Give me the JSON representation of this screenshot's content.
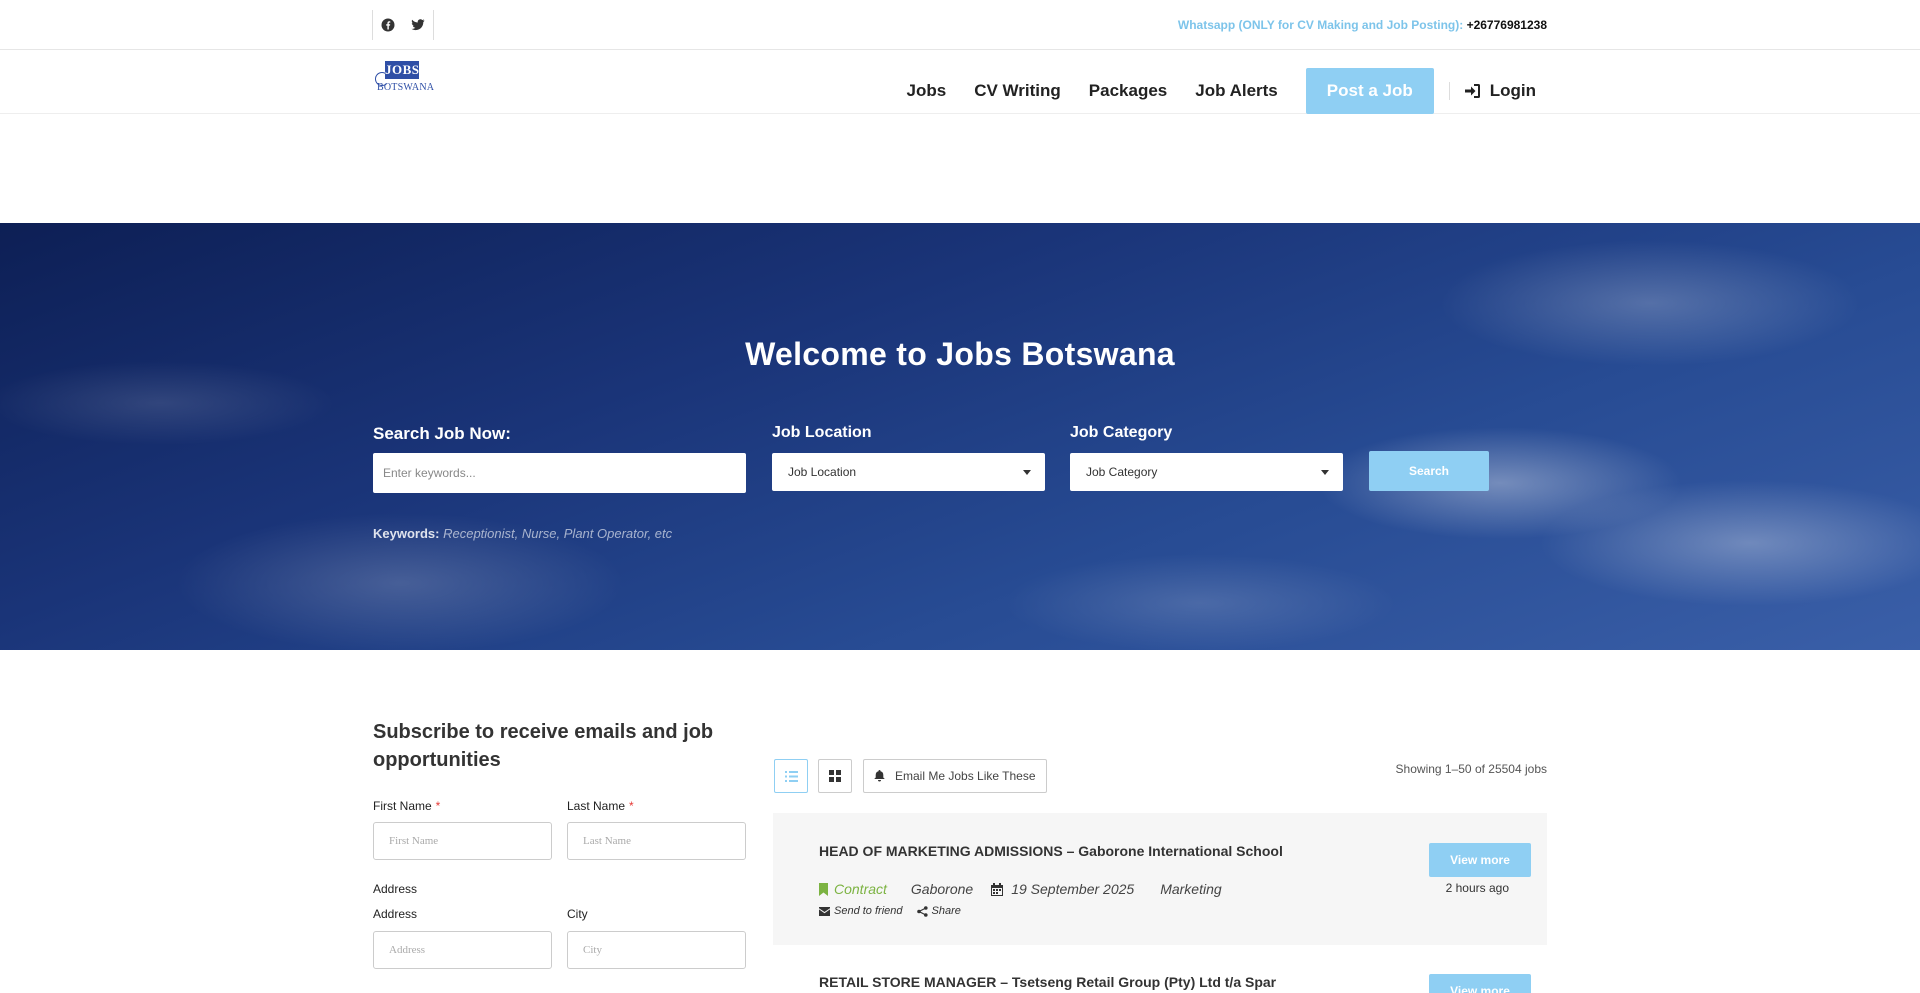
{
  "topbar": {
    "social_icons": [
      "facebook-icon",
      "twitter-icon"
    ],
    "whatsapp_label": "Whatsapp (ONLY for CV Making and Job Posting):",
    "whatsapp_number": "+26776981238"
  },
  "logo": {
    "main": "JOBS",
    "sub": "BOTSWANA"
  },
  "nav": {
    "jobs": "Jobs",
    "cv_writing": "CV Writing",
    "packages": "Packages",
    "job_alerts": "Job Alerts",
    "post_job": "Post a Job",
    "login": "Login"
  },
  "hero": {
    "title": "Welcome to Jobs Botswana",
    "search_label": "Search Job Now:",
    "search_placeholder": "Enter keywords...",
    "location_label": "Job Location",
    "location_value": "Job Location",
    "category_label": "Job Category",
    "category_value": "Job Category",
    "search_button": "Search",
    "keywords_label": "Keywords:",
    "keywords_examples": "Receptionist, Nurse, Plant Operator, etc"
  },
  "subscribe": {
    "heading": "Subscribe to receive emails and job opportunities",
    "first_name_label": "First Name",
    "first_name_placeholder": "First Name",
    "last_name_label": "Last Name",
    "last_name_placeholder": "Last Name",
    "required_mark": "*",
    "address_heading": "Address",
    "address_label": "Address",
    "address_placeholder": "Address",
    "city_label": "City",
    "city_placeholder": "City"
  },
  "listing": {
    "email_me": "Email Me Jobs Like These",
    "showing": "Showing 1–50 of 25504 jobs",
    "jobs": [
      {
        "title": "HEAD OF MARKETING ADMISSIONS – Gaborone International School",
        "type": "Contract",
        "location": "Gaborone",
        "date": "19 September 2025",
        "category": "Marketing",
        "send": "Send to friend",
        "share": "Share",
        "view": "View more",
        "ago": "2 hours ago"
      },
      {
        "title": "RETAIL STORE MANAGER – Tsetseng Retail Group (Pty) Ltd t/a Spar",
        "view": "View more"
      }
    ]
  },
  "colors": {
    "accent": "#8fcff3",
    "contract_green": "#7cb342",
    "hero_dark": "#0d1f55",
    "required": "#e53935"
  }
}
